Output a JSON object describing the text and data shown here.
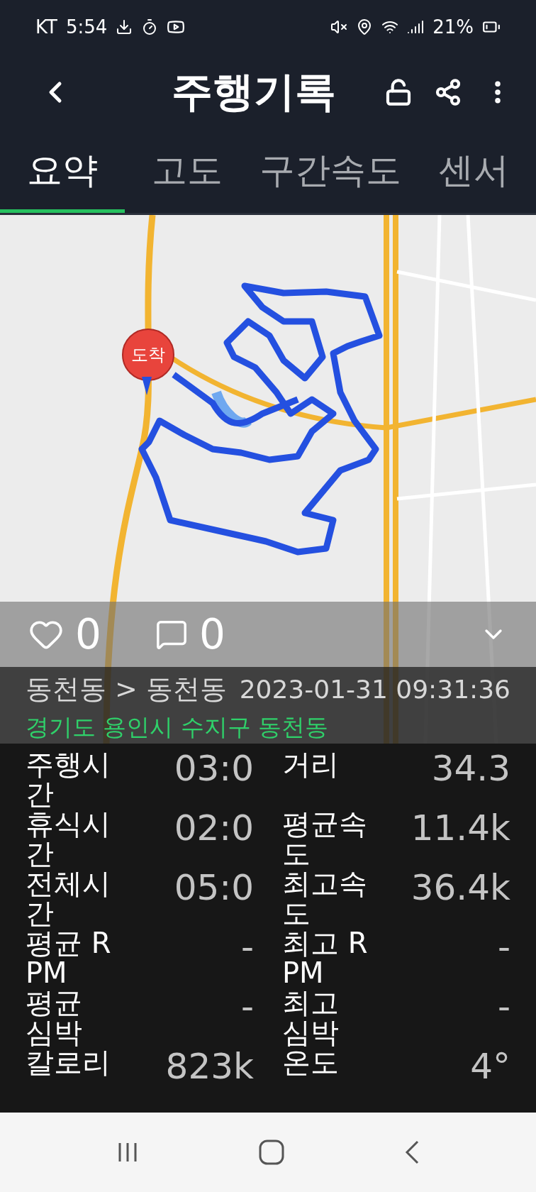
{
  "status_bar": {
    "carrier": "KT",
    "time": "5:54",
    "battery": "21%"
  },
  "header": {
    "title": "주행기록"
  },
  "tabs": [
    {
      "label": "요약",
      "selected": true
    },
    {
      "label": "고도",
      "selected": false
    },
    {
      "label": "구간속도",
      "selected": false
    },
    {
      "label": "센서",
      "selected": false
    }
  ],
  "map": {
    "marker_label": "도착"
  },
  "social": {
    "likes": "0",
    "comments": "0"
  },
  "route": {
    "title": "동천동 > 동천동",
    "datetime": "2023-01-31 09:31:36",
    "address": "경기도 용인시 수지구 동천동"
  },
  "stats": [
    {
      "label": "주행시간",
      "value": "03:0"
    },
    {
      "label": "거리",
      "value": "34.3"
    },
    {
      "label": "휴식시간",
      "value": "02:0"
    },
    {
      "label": "평균속도",
      "value": "11.4k"
    },
    {
      "label": "전체시간",
      "value": "05:0"
    },
    {
      "label": "최고속도",
      "value": "36.4k"
    },
    {
      "label": "평균 RPM",
      "value": "-"
    },
    {
      "label": "최고 RPM",
      "value": "-"
    },
    {
      "label": "평균 심박",
      "value": "-"
    },
    {
      "label": "최고 심박",
      "value": "-"
    },
    {
      "label": "칼로리",
      "value": "823k"
    },
    {
      "label": "온도",
      "value": "4°"
    }
  ]
}
